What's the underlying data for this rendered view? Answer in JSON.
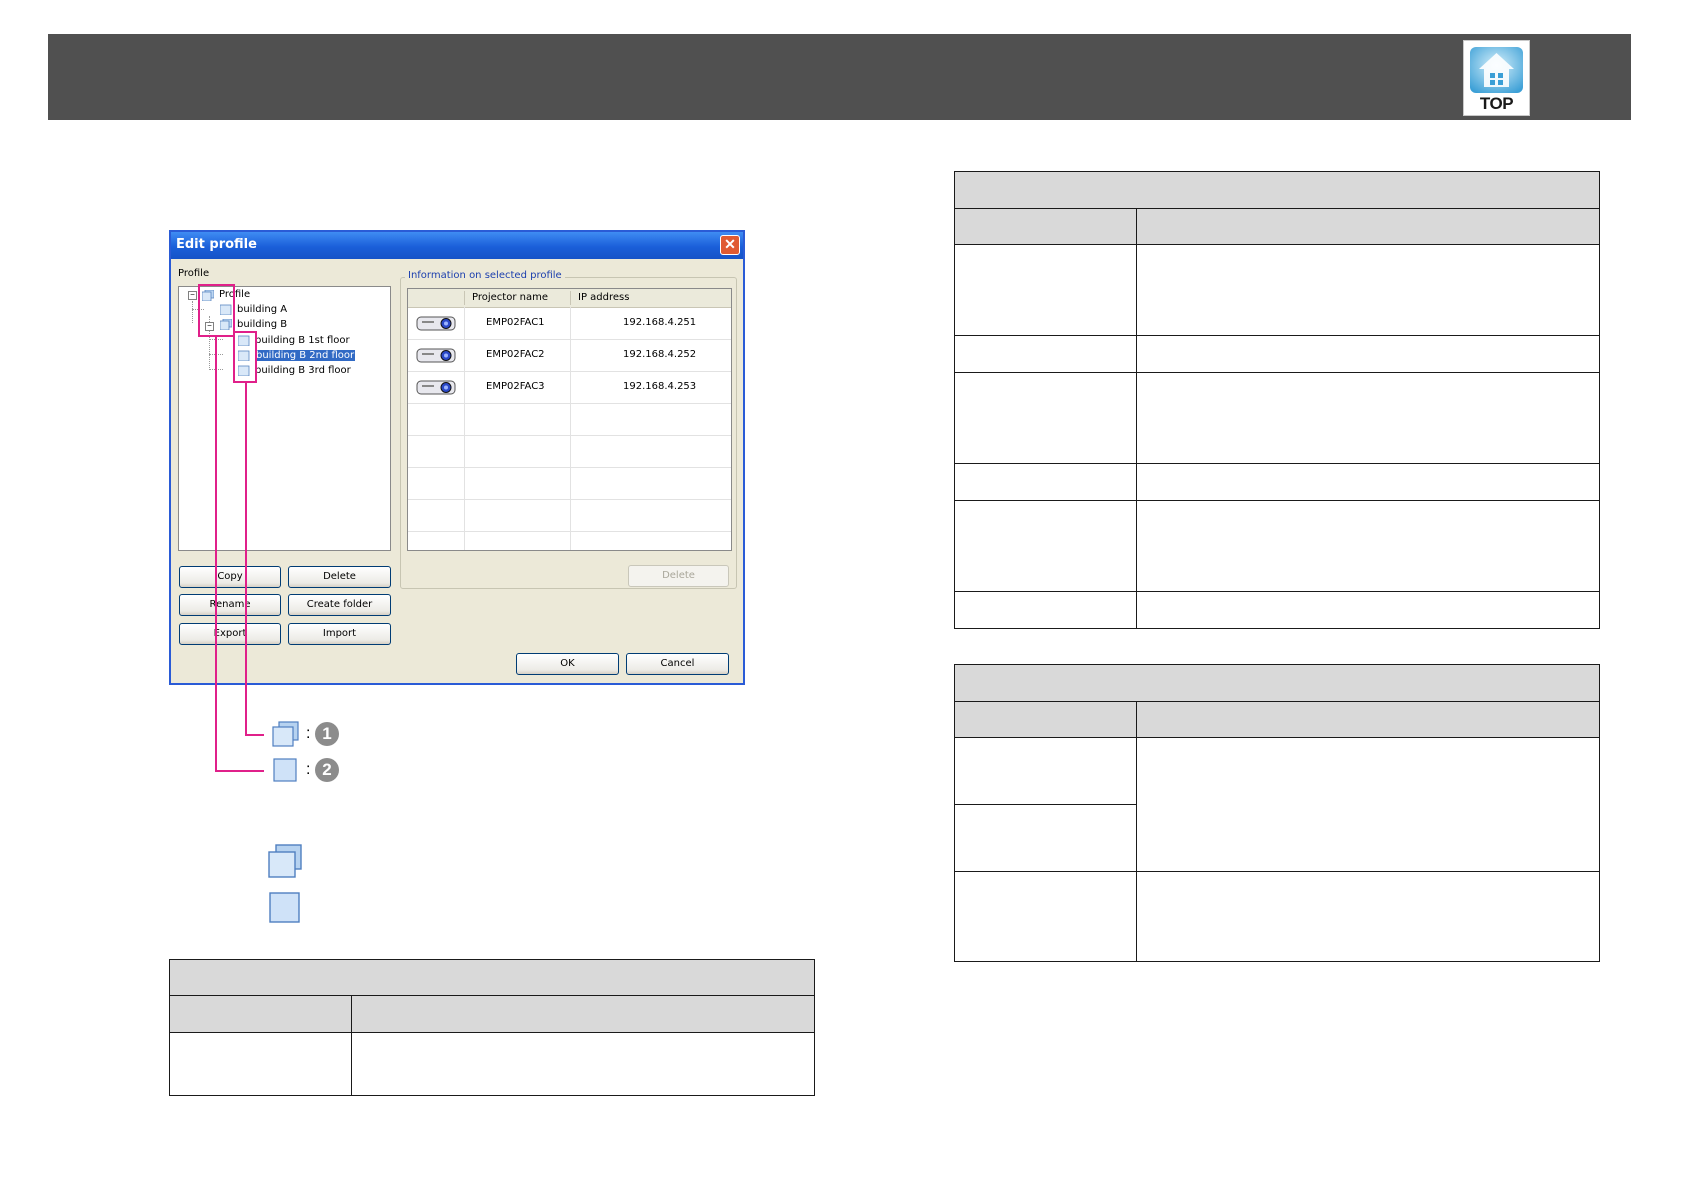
{
  "header": {
    "logo_text": "TOP"
  },
  "dialog": {
    "title": "Edit profile",
    "close_glyph": "✕",
    "profile_label": "Profile",
    "tree": [
      {
        "label": "Profile"
      },
      {
        "label": "building A"
      },
      {
        "label": "building B"
      },
      {
        "label": "building B 1st floor"
      },
      {
        "label": "building B 2nd floor",
        "selected": true
      },
      {
        "label": "building B 3rd floor"
      }
    ],
    "info_group_label": "Information on selected profile",
    "columns": [
      "Projector name",
      "IP address"
    ],
    "rows": [
      {
        "name": "EMP02FAC1",
        "ip": "192.168.4.251"
      },
      {
        "name": "EMP02FAC2",
        "ip": "192.168.4.252"
      },
      {
        "name": "EMP02FAC3",
        "ip": "192.168.4.253"
      }
    ],
    "buttons": {
      "copy": "Copy",
      "delete_profile": "Delete",
      "rename": "Rename",
      "create_folder": "Create folder",
      "export": "Export",
      "import": "Import",
      "delete_projector": "Delete",
      "ok": "OK",
      "cancel": "Cancel"
    }
  },
  "callouts": {
    "colon": ":",
    "one": "1",
    "two": "2"
  },
  "colors": {
    "header": "#505050",
    "highlight": "#e0208a",
    "table_fill": "#d9d9d9"
  }
}
